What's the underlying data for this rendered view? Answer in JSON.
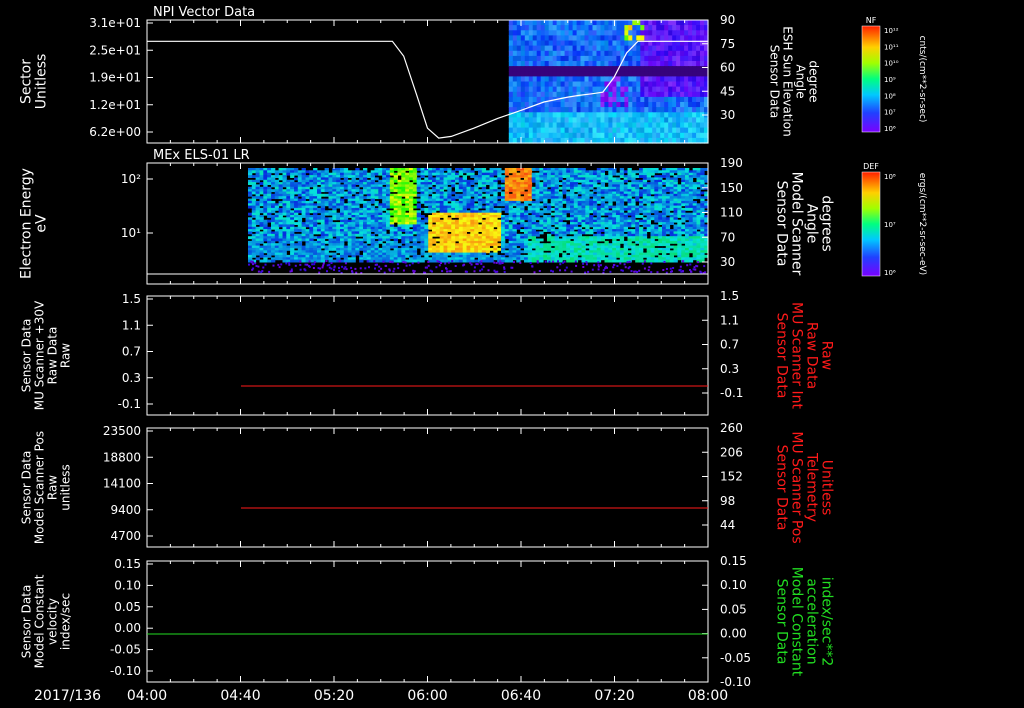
{
  "figure": {
    "date_label": "2017/136",
    "x_ticks": [
      "04:00",
      "04:40",
      "05:20",
      "06:00",
      "06:40",
      "07:20",
      "08:00"
    ],
    "x_range_hours": [
      4.0,
      8.0
    ]
  },
  "colors": {
    "background": "#000000",
    "foreground": "#ffffff",
    "red_trace": "#ff1a1a",
    "green_trace": "#22dd22"
  },
  "chart_data": [
    {
      "type": "heatmap",
      "title": "NPI Vector Data",
      "ylabel_left": [
        "Sector",
        "Unitless"
      ],
      "yticks_left": [
        "3.1e+01",
        "2.5e+01",
        "1.9e+01",
        "1.2e+01",
        "6.2e+00"
      ],
      "ylabel_right": [
        "Sensor Data",
        "ESH Sun Elevation",
        "Angle",
        "degree"
      ],
      "yticks_right": [
        "90",
        "75",
        "60",
        "45",
        "30"
      ],
      "ylim_right": [
        15,
        90
      ],
      "overlay_line": {
        "name": "",
        "color": "#ffffff",
        "x_hours": [
          4.0,
          5.75,
          5.83,
          5.92,
          6.0,
          6.08,
          6.17,
          6.33,
          6.5,
          6.67,
          6.83,
          7.0,
          7.08,
          7.17,
          7.25,
          7.33,
          7.42,
          7.5,
          7.67,
          8.0
        ],
        "y": [
          77,
          77,
          68,
          45,
          24,
          18,
          19,
          24,
          30,
          35,
          40,
          43,
          44,
          45,
          46,
          55,
          70,
          77,
          77,
          77
        ]
      },
      "heatmap_x_range_hours": [
        6.58,
        8.0
      ],
      "colorbar": {
        "label_top": "NF",
        "tick_labels": [
          "10¹²",
          "10¹¹",
          "10¹⁰",
          "10⁹",
          "10⁸",
          "10⁷",
          "10⁶"
        ],
        "units": "cnts/(cm**2-sr-sec)"
      }
    },
    {
      "type": "heatmap",
      "title": "MEx ELS-01 LR",
      "ylabel_left": [
        "Electron Energy",
        "eV"
      ],
      "yticks_left": [
        "10²",
        "10¹"
      ],
      "scale_left": "log",
      "ylabel_right": [
        "Sensor Data",
        "Model Scanner",
        "Angle",
        "degrees"
      ],
      "yticks_right": [
        "190",
        "150",
        "110",
        "70",
        "30"
      ],
      "ylim_right": [
        0,
        190
      ],
      "overlay_line": {
        "name": "",
        "color": "#ffffff",
        "x_hours": [
          4.0,
          8.0
        ],
        "y": [
          10,
          10
        ]
      },
      "heatmap_x_range_hours": [
        4.72,
        8.0
      ],
      "colorbar": {
        "label_top": "DEF",
        "tick_labels": [
          "10⁸",
          "10⁷",
          "10⁶"
        ],
        "units": "ergs/(cm**2-sr-sec-eV)"
      }
    },
    {
      "type": "line",
      "title": "",
      "ylabel_left": [
        "Sensor Data",
        "MU Scanner +30V",
        "Raw Data",
        "Raw"
      ],
      "yticks_left": [
        "1.5",
        "1.1",
        "0.7",
        "0.3",
        "-0.1"
      ],
      "ylim_left": [
        -0.5,
        1.5
      ],
      "ylabel_right": [
        "Sensor Data",
        "MU Scanner Int",
        "Raw Data",
        "Raw"
      ],
      "ylabel_right_color": "#ff1a1a",
      "yticks_right": [
        "1.5",
        "1.1",
        "0.7",
        "0.3",
        "-0.1"
      ],
      "series": [
        {
          "color": "#ff1a1a",
          "x_hours": [
            4.67,
            8.0
          ],
          "y": [
            0.0,
            0.0
          ]
        }
      ]
    },
    {
      "type": "line",
      "title": "",
      "ylabel_left": [
        "Sensor Data",
        "Model Scanner Pos",
        "Raw",
        "unitless"
      ],
      "yticks_left": [
        "23500",
        "18800",
        "14100",
        "9400",
        "4700"
      ],
      "ylim_left": [
        0,
        23500
      ],
      "ylabel_right": [
        "Sensor Data",
        "MU Scanner Pos",
        "Telemetry",
        "Unitless"
      ],
      "ylabel_right_color": "#ff1a1a",
      "yticks_right": [
        "260",
        "206",
        "152",
        "98",
        "44"
      ],
      "series": [
        {
          "color": "#ff1a1a",
          "x_hours": [
            4.67,
            8.0
          ],
          "y": [
            8200,
            8200
          ]
        }
      ]
    },
    {
      "type": "line",
      "title": "",
      "ylabel_left": [
        "Sensor Data",
        "Model Constant",
        "velocity",
        "index/sec"
      ],
      "yticks_left": [
        "0.15",
        "0.10",
        "0.05",
        "0.00",
        "-0.05",
        "-0.10"
      ],
      "ylim_left": [
        -0.1,
        0.15
      ],
      "ylabel_right": [
        "Sensor Data",
        "Model Constant",
        "acceleration",
        "index/sec**2"
      ],
      "ylabel_right_color": "#22dd22",
      "yticks_right": [
        "0.15",
        "0.10",
        "0.05",
        "0.00",
        "-0.05",
        "-0.10"
      ],
      "series": [
        {
          "color": "#22dd22",
          "x_hours": [
            4.0,
            8.0
          ],
          "y": [
            0.0,
            0.0
          ]
        }
      ]
    }
  ]
}
